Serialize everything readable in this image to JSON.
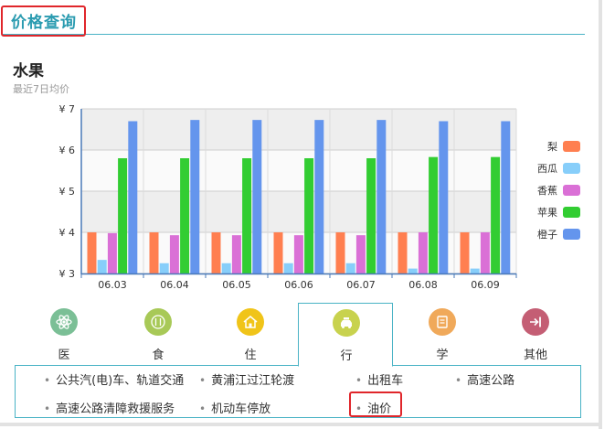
{
  "header": {
    "title": "价格查询"
  },
  "section": {
    "title": "水果",
    "subtitle": "最近7日均价"
  },
  "chart_data": {
    "type": "bar",
    "categories": [
      "06.03",
      "06.04",
      "06.05",
      "06.06",
      "06.07",
      "06.08",
      "06.09"
    ],
    "series": [
      {
        "name": "梨",
        "color": "#ff7f50",
        "values": [
          4.0,
          4.0,
          4.0,
          4.0,
          4.0,
          4.0,
          4.0
        ]
      },
      {
        "name": "西瓜",
        "color": "#87cefa",
        "values": [
          3.33,
          3.25,
          3.25,
          3.25,
          3.25,
          3.12,
          3.12
        ]
      },
      {
        "name": "香蕉",
        "color": "#da70d6",
        "values": [
          3.98,
          3.93,
          3.93,
          3.93,
          3.93,
          4.0,
          4.0
        ]
      },
      {
        "name": "苹果",
        "color": "#32cd32",
        "values": [
          5.8,
          5.8,
          5.8,
          5.8,
          5.8,
          5.83,
          5.83
        ]
      },
      {
        "name": "橙子",
        "color": "#6495ed",
        "values": [
          6.7,
          6.73,
          6.73,
          6.73,
          6.73,
          6.7,
          6.7
        ]
      }
    ],
    "yticks": [
      "¥ 3",
      "¥ 4",
      "¥ 5",
      "¥ 6",
      "¥ 7"
    ],
    "ylim": [
      3,
      7
    ],
    "legend": "right",
    "grid": true
  },
  "categories": [
    {
      "label": "医",
      "icon": "atom-icon",
      "color": "#7bbf96"
    },
    {
      "label": "食",
      "icon": "utensils-icon",
      "color": "#a8c957"
    },
    {
      "label": "住",
      "icon": "house-icon",
      "color": "#f0c419"
    },
    {
      "label": "行",
      "icon": "taxi-icon",
      "color": "#c8d24e"
    },
    {
      "label": "学",
      "icon": "book-icon",
      "color": "#f0a95a"
    },
    {
      "label": "其他",
      "icon": "exit-icon",
      "color": "#c45e74"
    }
  ],
  "links": [
    "公共汽(电)车、轨道交通",
    "黄浦江过江轮渡",
    "出租车",
    "高速公路",
    "高速公路清障救援服务",
    "机动车停放",
    "油价"
  ]
}
